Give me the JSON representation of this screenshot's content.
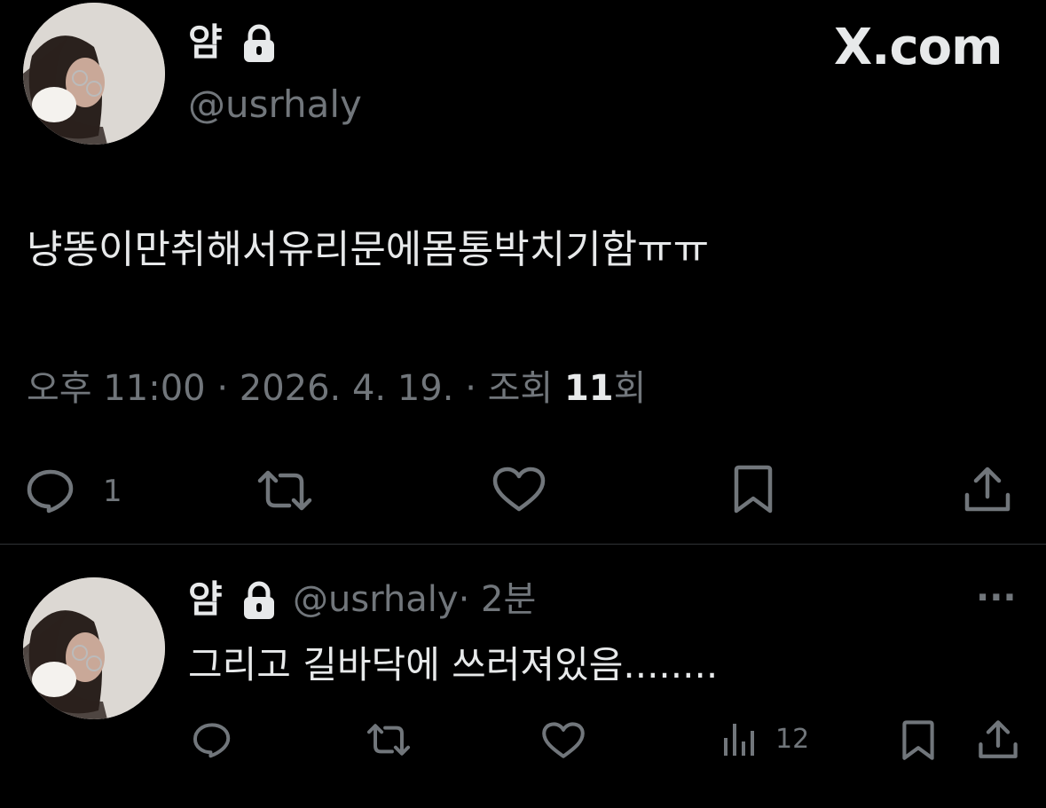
{
  "main_post": {
    "display_name": "얌",
    "handle": "@usrhaly",
    "brand": "X.com",
    "text": "냥똥이만취해서유리문에몸통박치기함ㅠㅠ",
    "meta": {
      "time": "오후 11:00",
      "sep1": "·",
      "date": "2026. 4. 19.",
      "sep2": "·",
      "views_label": "조회",
      "views_count": "11",
      "views_suffix": "회"
    },
    "actions": {
      "reply_count": "1"
    }
  },
  "reply": {
    "display_name": "얌",
    "handle": "@usrhaly",
    "time": "· 2분",
    "text": "그리고 길바닥에 쓰러져있음........",
    "more": "···",
    "views_count": "12"
  },
  "colors": {
    "background": "#000000",
    "text": "#e7e9ea",
    "muted": "#71767b",
    "divider": "#2f3336"
  }
}
